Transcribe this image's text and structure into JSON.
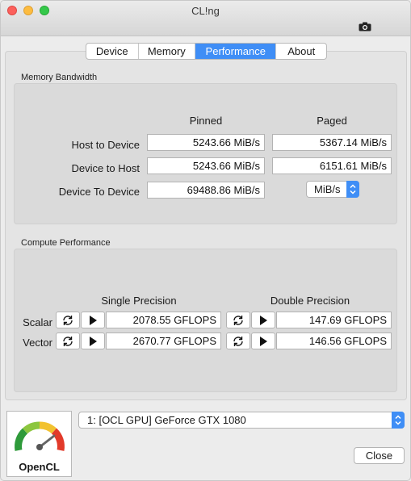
{
  "window": {
    "title": "CL!ng"
  },
  "tabs": [
    {
      "label": "Device",
      "active": false
    },
    {
      "label": "Memory",
      "active": false
    },
    {
      "label": "Performance",
      "active": true
    },
    {
      "label": "About",
      "active": false
    }
  ],
  "memory_bandwidth": {
    "group_label": "Memory Bandwidth",
    "col_pinned": "Pinned",
    "col_paged": "Paged",
    "rows": [
      {
        "label": "Host to Device",
        "pinned": "5243.66 MiB/s",
        "paged": "5367.14 MiB/s"
      },
      {
        "label": "Device to Host",
        "pinned": "5243.66 MiB/s",
        "paged": "6151.61 MiB/s"
      },
      {
        "label": "Device To Device",
        "pinned": "69488.86 MiB/s"
      }
    ],
    "unit_select": "MiB/s"
  },
  "compute_performance": {
    "group_label": "Compute Performance",
    "col_single": "Single Precision",
    "col_double": "Double Precision",
    "rows": [
      {
        "label": "Scalar",
        "single": "2078.55 GFLOPS",
        "double": "147.69 GFLOPS"
      },
      {
        "label": "Vector",
        "single": "2670.77 GFLOPS",
        "double": "146.56 GFLOPS"
      }
    ]
  },
  "device_select": {
    "value": "1: [OCL GPU] GeForce GTX 1080"
  },
  "logo": {
    "text": "OpenCL"
  },
  "close_label": "Close",
  "colors": {
    "accent": "#3f8ef6"
  }
}
